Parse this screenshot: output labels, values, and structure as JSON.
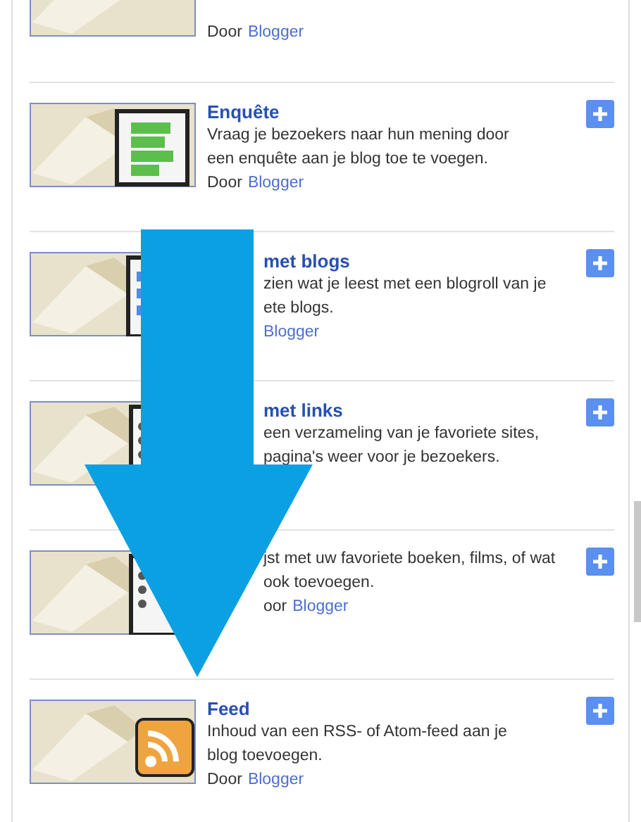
{
  "widgets": [
    {
      "kind": "video",
      "byline": "Door",
      "link": "Blogger",
      "partly_hidden": false
    },
    {
      "kind": "poll",
      "title": "Enquête",
      "description": [
        "Vraag je bezoekers naar hun mening door",
        "een enquête aan je blog toe te voegen."
      ],
      "byline": "Door",
      "link": "Blogger",
      "partly_hidden": false
    },
    {
      "kind": "blogs",
      "title": "met blogs",
      "description": [
        "zien wat je leest met een blogroll van je",
        "ete blogs."
      ],
      "link": "Blogger",
      "partly_hidden": true
    },
    {
      "kind": "links",
      "title": "met links",
      "description": [
        "een verzameling van je favoriete sites,",
        "pagina's weer voor je bezoekers."
      ],
      "partly_hidden": true
    },
    {
      "kind": "list",
      "description": [
        "jst met uw favoriete boeken, films, of wat",
        "ook toevoegen."
      ],
      "byline": "oor",
      "link": "Blogger",
      "partly_hidden": true
    },
    {
      "kind": "feed",
      "title": "Feed",
      "description": [
        "Inhoud van een RSS- of Atom-feed aan je",
        "blog toevoegen."
      ],
      "byline": "Door",
      "link": "Blogger",
      "partly_hidden": false
    }
  ],
  "overlay": {
    "kind": "down-arrow"
  }
}
